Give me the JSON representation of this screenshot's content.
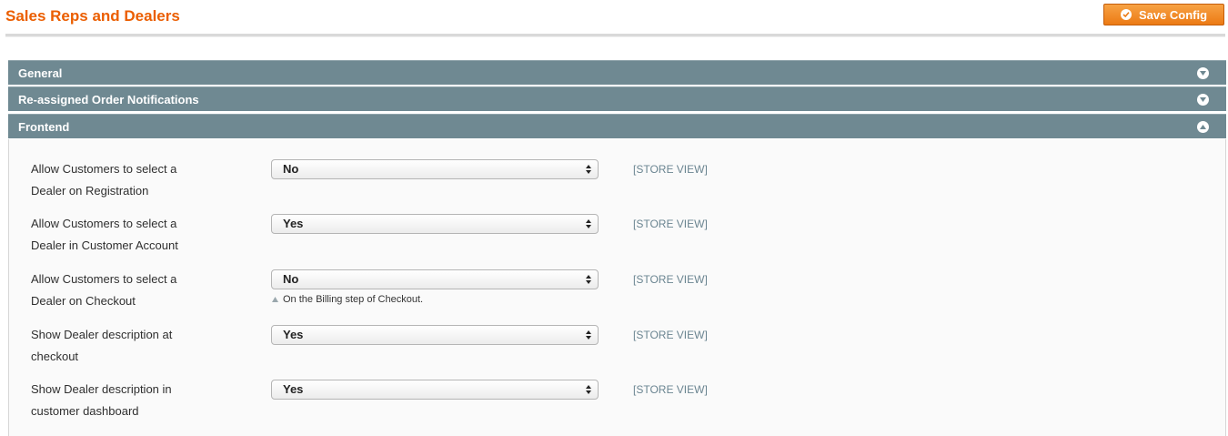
{
  "page": {
    "title": "Sales Reps and Dealers",
    "save_label": "Save Config"
  },
  "sections": [
    {
      "label": "General",
      "expanded": false
    },
    {
      "label": "Re-assigned Order Notifications",
      "expanded": false
    },
    {
      "label": "Frontend",
      "expanded": true
    }
  ],
  "frontend": {
    "rows": [
      {
        "label_line1": "Allow Customers to select a",
        "label_line2": "Dealer on Registration",
        "value": "No",
        "scope": "[STORE VIEW]"
      },
      {
        "label_line1": "Allow Customers to select a",
        "label_line2": "Dealer in Customer Account",
        "value": "Yes",
        "scope": "[STORE VIEW]"
      },
      {
        "label_line1": "Allow Customers to select a",
        "label_line2": "Dealer on Checkout",
        "value": "No",
        "scope": "[STORE VIEW]",
        "note": "On the Billing step of Checkout."
      },
      {
        "label_line1": "Show Dealer description at",
        "label_line2": "checkout",
        "value": "Yes",
        "scope": "[STORE VIEW]"
      },
      {
        "label_line1": "Show Dealer description in",
        "label_line2": "customer dashboard",
        "value": "Yes",
        "scope": "[STORE VIEW]"
      }
    ]
  },
  "colors": {
    "title": "#eb5e00",
    "button": "#ec7a14",
    "section_header": "#6f8992",
    "scope_text": "#6b8591"
  },
  "icons": {
    "save": "checkmark-icon",
    "collapsed": "chevron-down-icon",
    "expanded": "chevron-up-icon",
    "select": "select-arrows-icon",
    "note": "triangle-up-icon"
  }
}
